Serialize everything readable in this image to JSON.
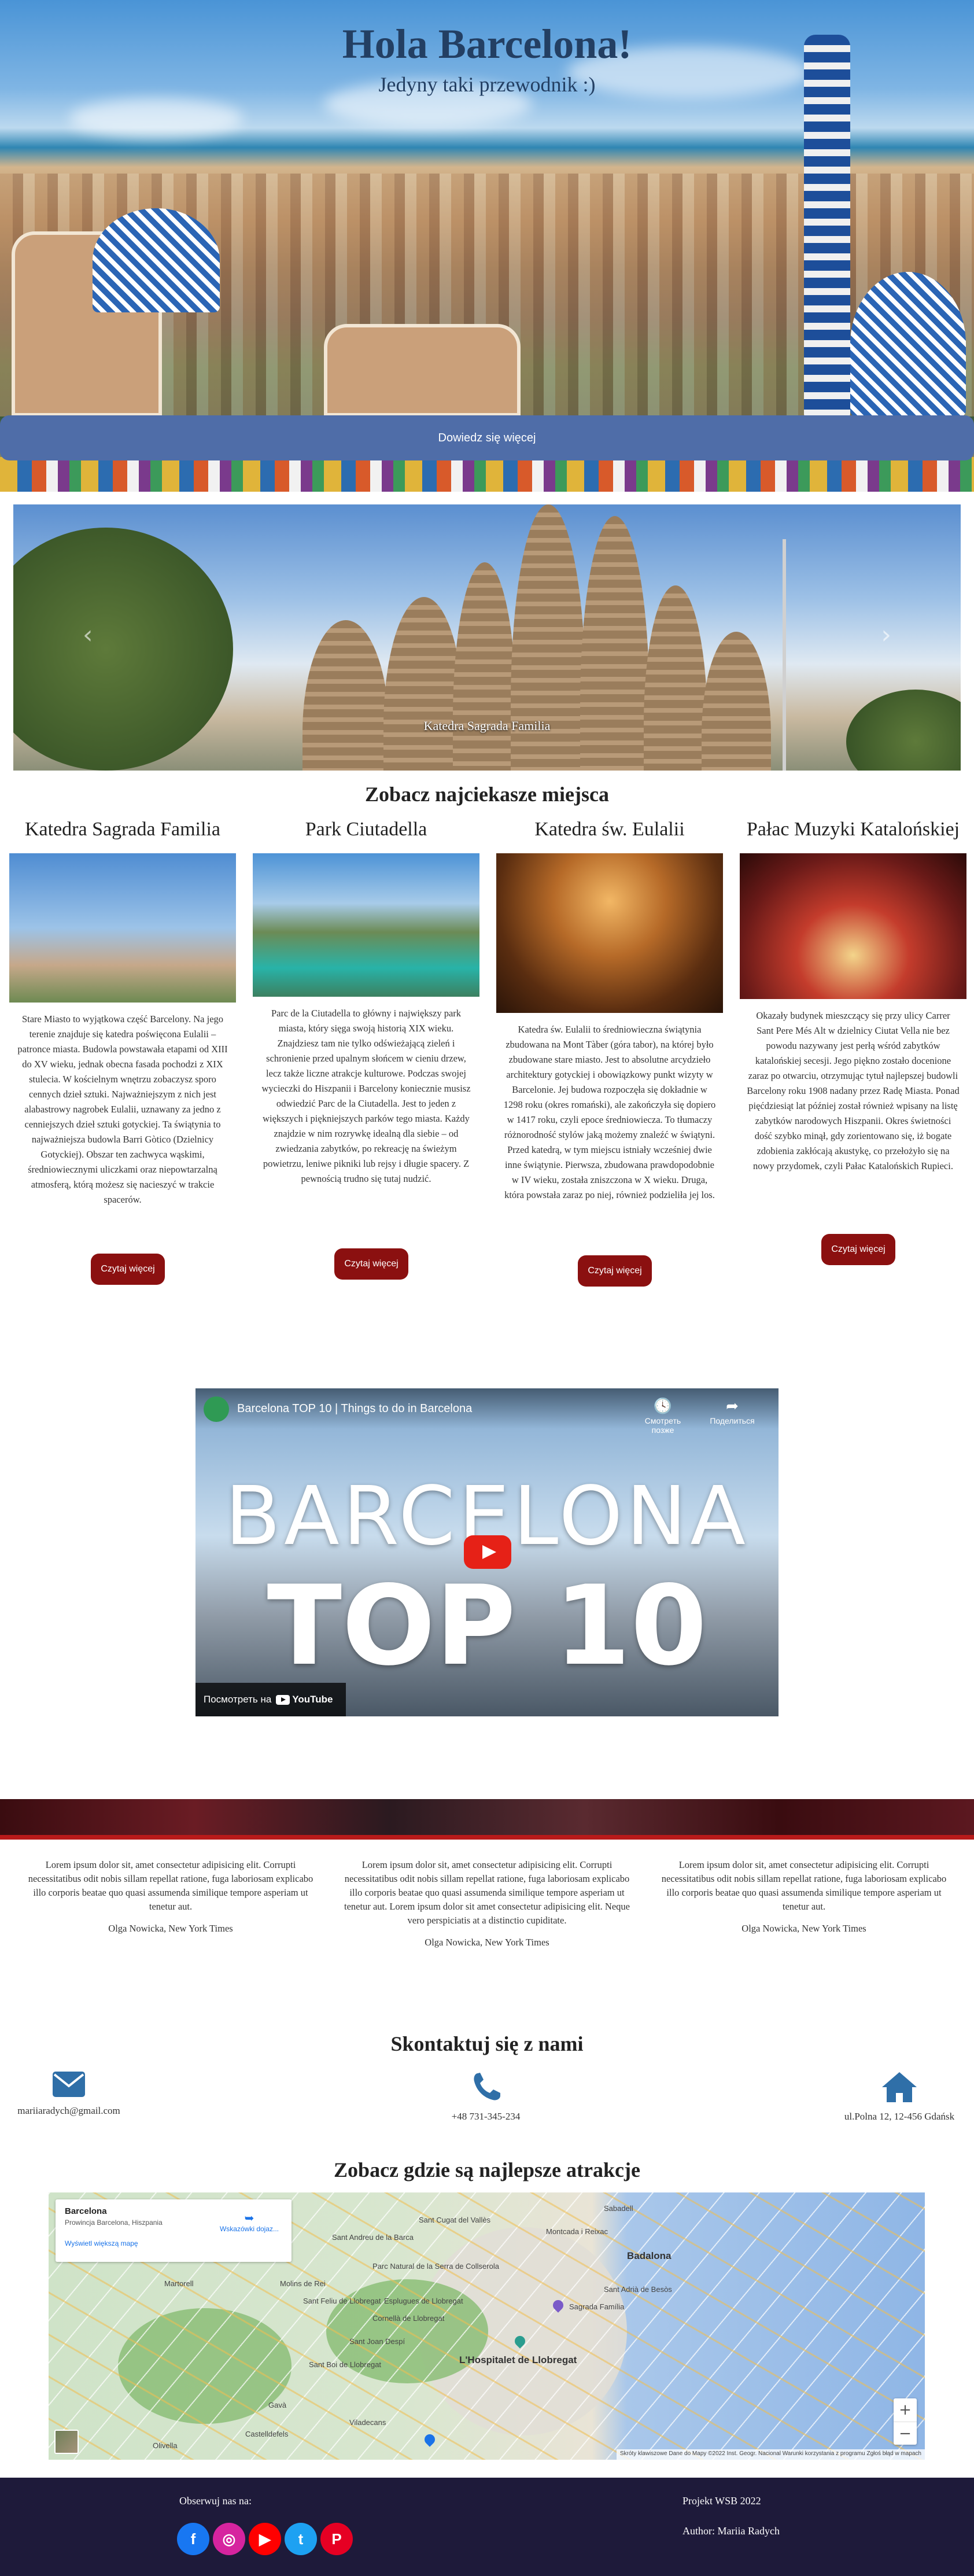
{
  "hero": {
    "title": "Hola Barcelona!",
    "subtitle": "Jedyny taki przewodnik :)",
    "button_label": "Dowiedz się więcej"
  },
  "carousel": {
    "caption": "Katedra Sagrada Familia",
    "prev_icon": "chevron-left-icon",
    "next_icon": "chevron-right-icon"
  },
  "attractions": {
    "heading": "Zobacz najciekasze miejsca",
    "read_more_label": "Czytaj więcej",
    "items": [
      {
        "title": "Katedra Sagrada Familia",
        "text": "Stare Miasto to wyjątkowa część Barcelony. Na jego terenie znajduje się katedra poświęcona Eulalii – patronce miasta. Budowla powstawała etapami od XIII do XV wieku, jednak obecna fasada pochodzi z XIX stulecia. W kościelnym wnętrzu zobaczysz sporo cennych dzieł sztuki. Najważniejszym z nich jest alabastrowy nagrobek Eulalii, uznawany za jedno z cenniejszych dzieł sztuki gotyckiej. Ta świątynia to najważniejsza budowla Barri Gòtico (Dzielnicy Gotyckiej). Obszar ten zachwyca wąskimi, średniowiecznymi uliczkami oraz niepowtarzalną atmosferą, którą możesz się nacieszyć w trakcie spacerów."
      },
      {
        "title": "Park Ciutadella",
        "text": "Parc de la Ciutadella to główny i największy park miasta, który sięga swoją historią XIX wieku. Znajdziesz tam nie tylko odświeżającą zieleń i schronienie przed upalnym słońcem w cieniu drzew, lecz także liczne atrakcje kulturowe. Podczas swojej wycieczki do Hiszpanii i Barcelony koniecznie musisz odwiedzić Parc de la Ciutadella. Jest to jeden z większych i piękniejszych parków tego miasta. Każdy znajdzie w nim rozrywkę idealną dla siebie – od zwiedzania zabytków, po rekreację na świeżym powietrzu, leniwe pikniki lub rejsy i długie spacery. Z pewnością trudno się tutaj nudzić."
      },
      {
        "title": "Katedra św. Eulalii",
        "text": "Katedra św. Eulalii to średniowieczna świątynia zbudowana na Mont Tàber (góra tabor), na której było zbudowane stare miasto. Jest to absolutne arcydzieło architektury gotyckiej i obowiązkowy punkt wizyty w Barcelonie. Jej budowa rozpoczęła się dokładnie w 1298 roku (okres romański), ale zakończyła się dopiero w 1417 roku, czyli epoce średniowiecza. To tłumaczy różnorodność stylów jaką możemy znaleźć w świątyni. Przed katedrą, w tym miejscu istniały wcześniej dwie inne świątynie. Pierwsza, zbudowana prawdopodobnie w IV wieku, została zniszczona w X wieku. Druga, która powstała zaraz po niej, również podzieliła jej los."
      },
      {
        "title": "Pałac Muzyki Katalońskiej",
        "text": "Okazały budynek mieszczący się przy ulicy Carrer Sant Pere Més Alt w dzielnicy Ciutat Vella nie bez powodu nazywany jest perłą wśród zabytków katalońskiej secesji. Jego piękno zostało docenione zaraz po otwarciu, otrzymując tytuł najlepszej budowli Barcelony roku 1908 nadany przez Radę Miasta. Ponad pięćdziesiąt lat później został również wpisany na listę zabytków narodowych Hiszpanii. Okres świetności dość szybko minął, gdy zorientowano się, iż bogate zdobienia zakłócają akustykę, co przełożyło się na nowy przydomek, czyli Pałac Katalońskich Rupieci."
      }
    ]
  },
  "video": {
    "title": "Barcelona TOP 10 | Things to do in Barcelona",
    "watch_later_label": "Смотреть позже",
    "share_label": "Поделиться",
    "watch_on_label": "Посмотреть на",
    "youtube_label": "YouTube",
    "overlay_line1": "BARCELONA",
    "overlay_line2": "TOP 10"
  },
  "testimonials": [
    {
      "text": "Lorem ipsum dolor sit, amet consectetur adipisicing elit. Corrupti necessitatibus odit nobis sillam repellat ratione, fuga laboriosam explicabo illo corporis beatae quo quasi assumenda similique tempore asperiam ut tenetur aut.",
      "author": "Olga Nowicka, New York Times"
    },
    {
      "text": "Lorem ipsum dolor sit, amet consectetur adipisicing elit. Corrupti necessitatibus odit nobis sillam repellat ratione, fuga laboriosam explicabo illo corporis beatae quo quasi assumenda similique tempore asperiam ut tenetur aut. Lorem ipsum dolor sit amet consectetur adipisicing elit. Neque vero perspiciatis at a distinctio cupiditate.",
      "author": "Olga Nowicka, New York Times"
    },
    {
      "text": "Lorem ipsum dolor sit, amet consectetur adipisicing elit. Corrupti necessitatibus odit nobis sillam repellat ratione, fuga laboriosam explicabo illo corporis beatae quo quasi assumenda similique tempore asperiam ut tenetur aut.",
      "author": "Olga Nowicka, New York Times"
    }
  ],
  "contact": {
    "heading": "Skontaktuj się z nami",
    "email": "mariiaradych@gmail.com",
    "phone": "+48 731-345-234",
    "address": "ul.Polna 12, 12-456 Gdańsk",
    "email_icon": "envelope-icon",
    "phone_icon": "phone-icon",
    "address_icon": "home-icon",
    "icon_color": "#2f6fa8"
  },
  "map": {
    "heading": "Zobacz gdzie są najlepsze atrakcje",
    "place_name": "Barcelona",
    "place_address": "Prowincja Barcelona, Hiszpania",
    "larger_map_link": "Wyświetl większą mapę",
    "directions_label": "Wskazówki dojaz...",
    "labels": [
      "Sant Cugat del Vallès",
      "Badalona",
      "L'Hospitalet de Llobregat",
      "Sant Andreu de la Barca",
      "Sabadell",
      "Montcada i Reixac",
      "Sant Adrià de Besòs",
      "Cornellà de Llobregat",
      "Sant Boi de Llobregat",
      "Viladecans",
      "Castelldefels",
      "Gavà",
      "Molins de Rei",
      "Martorell",
      "Sant Joan Despí",
      "Esplugues de Llobregat",
      "Sant Feliu de Llobregat",
      "Olivella",
      "Sagrada Família",
      "Parc Natural de la Serra de Collserola"
    ],
    "zoom_in": "+",
    "zoom_out": "−",
    "attribution": "Skróty klawiszowe   Dane do Mapy ©2022 Inst. Geogr. Nacional   Warunki korzystania z programu   Zgłoś błąd w mapach"
  },
  "footer": {
    "follow_label": "Obserwuj nas na:",
    "social": [
      {
        "name": "facebook-icon",
        "glyph": "f",
        "color": "#1877f2"
      },
      {
        "name": "instagram-icon",
        "glyph": "◎",
        "color": "#d6249f"
      },
      {
        "name": "youtube-icon",
        "glyph": "▶",
        "color": "#ff0000"
      },
      {
        "name": "twitter-icon",
        "glyph": "t",
        "color": "#1da1f2"
      },
      {
        "name": "pinterest-icon",
        "glyph": "P",
        "color": "#e60023"
      }
    ],
    "project": "Projekt WSB 2022",
    "author": "Author: Mariia Radych",
    "background": "#1e1a3a"
  },
  "colors": {
    "accent_red": "#8b1010",
    "hero_button": "#4f6da8",
    "title_navy": "#233f63"
  }
}
